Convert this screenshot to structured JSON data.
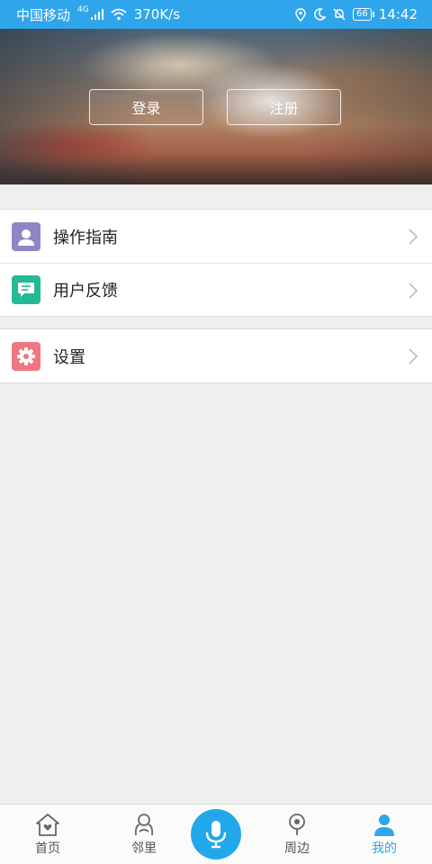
{
  "status_bar": {
    "carrier": "中国移动",
    "network": "4G",
    "speed": "370K/s",
    "battery": "66",
    "time": "14:42"
  },
  "hero": {
    "login_label": "登录",
    "register_label": "注册"
  },
  "menu": {
    "groups": [
      [
        {
          "label": "操作指南",
          "icon": "guide-person-icon",
          "color": "#8f86c5"
        },
        {
          "label": "用户反馈",
          "icon": "chat-feedback-icon",
          "color": "#25b994"
        }
      ],
      [
        {
          "label": "设置",
          "icon": "gear-icon",
          "color": "#ef7683"
        }
      ]
    ]
  },
  "bottom_nav": {
    "items": [
      {
        "label": "首页",
        "icon": "home-icon"
      },
      {
        "label": "邻里",
        "icon": "neighbor-icon"
      },
      {
        "label": "周边",
        "icon": "nearby-icon"
      },
      {
        "label": "我的",
        "icon": "profile-icon"
      }
    ],
    "center": {
      "icon": "microphone-icon",
      "color": "#22a7ec"
    }
  },
  "colors": {
    "accent": "#2fa6ec",
    "background": "#efefef"
  }
}
